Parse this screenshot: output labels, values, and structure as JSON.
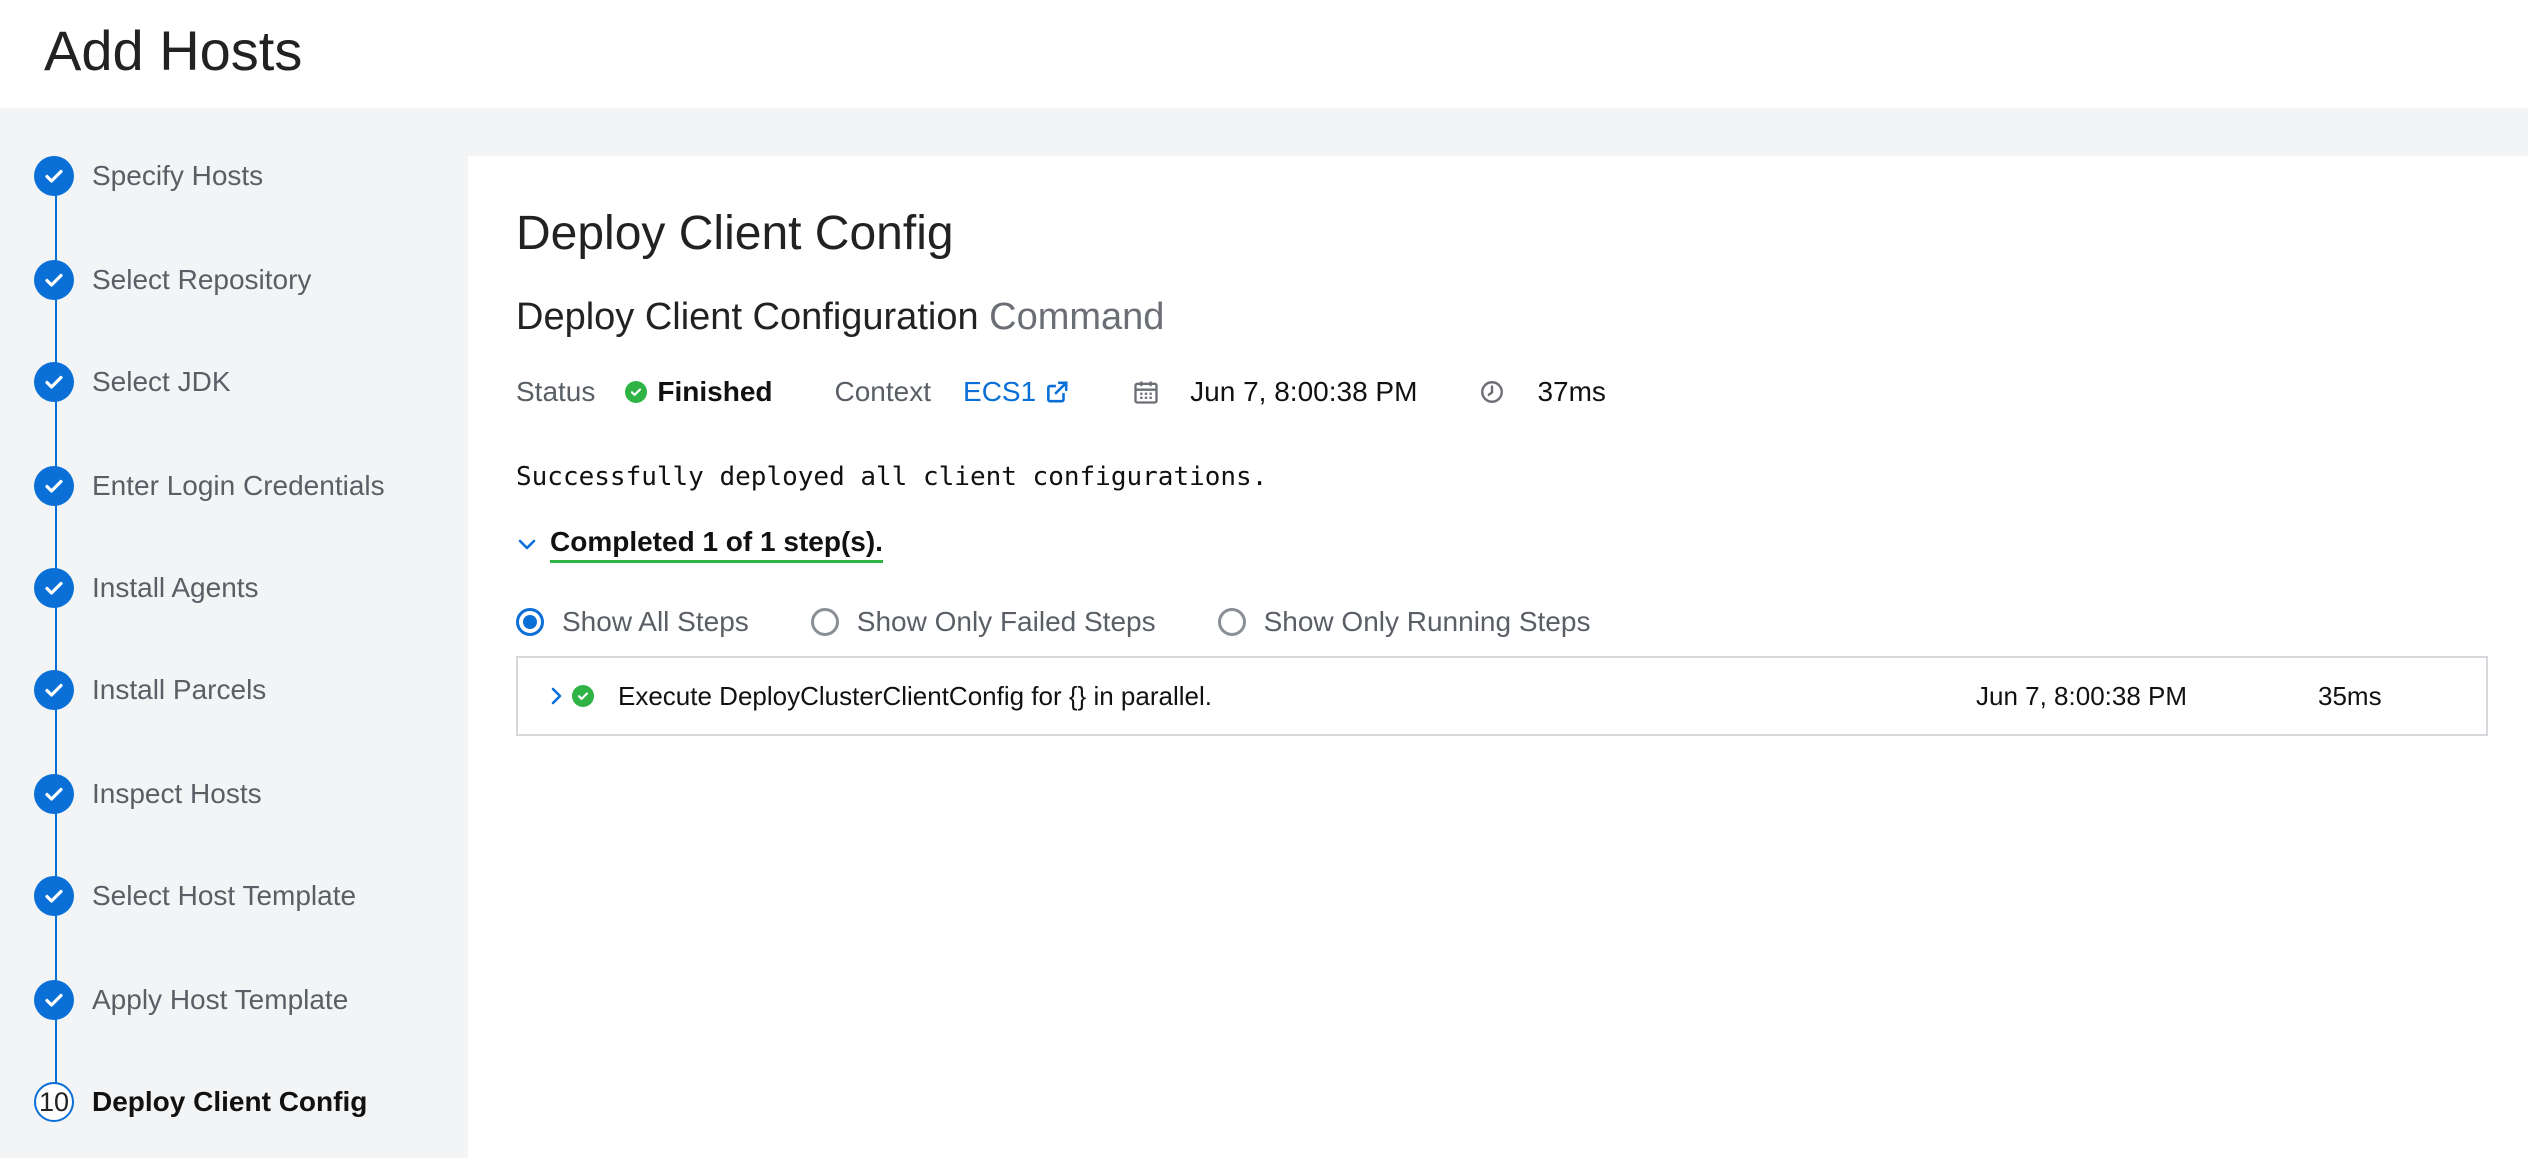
{
  "header": {
    "title": "Add Hosts"
  },
  "wizard": {
    "steps": [
      {
        "label": "Specify Hosts",
        "state": "done"
      },
      {
        "label": "Select Repository",
        "state": "done"
      },
      {
        "label": "Select JDK",
        "state": "done"
      },
      {
        "label": "Enter Login Credentials",
        "state": "done"
      },
      {
        "label": "Install Agents",
        "state": "done"
      },
      {
        "label": "Install Parcels",
        "state": "done"
      },
      {
        "label": "Inspect Hosts",
        "state": "done"
      },
      {
        "label": "Select Host Template",
        "state": "done"
      },
      {
        "label": "Apply Host Template",
        "state": "done"
      },
      {
        "label": "Deploy Client Config",
        "state": "current",
        "number": "10"
      }
    ]
  },
  "main": {
    "section_title": "Deploy Client Config",
    "command_title": "Deploy Client Configuration",
    "command_suffix": "Command",
    "status_label": "Status",
    "status_value": "Finished",
    "context_label": "Context",
    "context_value": "ECS1",
    "started_at": "Jun 7, 8:00:38 PM",
    "duration": "37ms",
    "result_message": "Successfully deployed all client configurations.",
    "steps_summary": "Completed 1 of 1 step(s).",
    "filters": [
      {
        "label": "Show All Steps",
        "checked": true
      },
      {
        "label": "Show Only Failed Steps",
        "checked": false
      },
      {
        "label": "Show Only Running Steps",
        "checked": false
      }
    ],
    "steps": [
      {
        "description": "Execute DeployClusterClientConfig for {} in parallel.",
        "started_at": "Jun 7, 8:00:38 PM",
        "duration": "35ms"
      }
    ]
  },
  "icons": {
    "step_done": "check-circle-icon",
    "status": "check-circle-icon",
    "context_link": "external-link-icon",
    "date": "calendar-icon",
    "duration": "clock-icon",
    "collapse": "chevron-down-icon",
    "expand": "chevron-right-icon"
  },
  "colors": {
    "accent": "#0a6fd6",
    "success": "#2fb344",
    "sidebar_bg": "#f3f4f6"
  }
}
